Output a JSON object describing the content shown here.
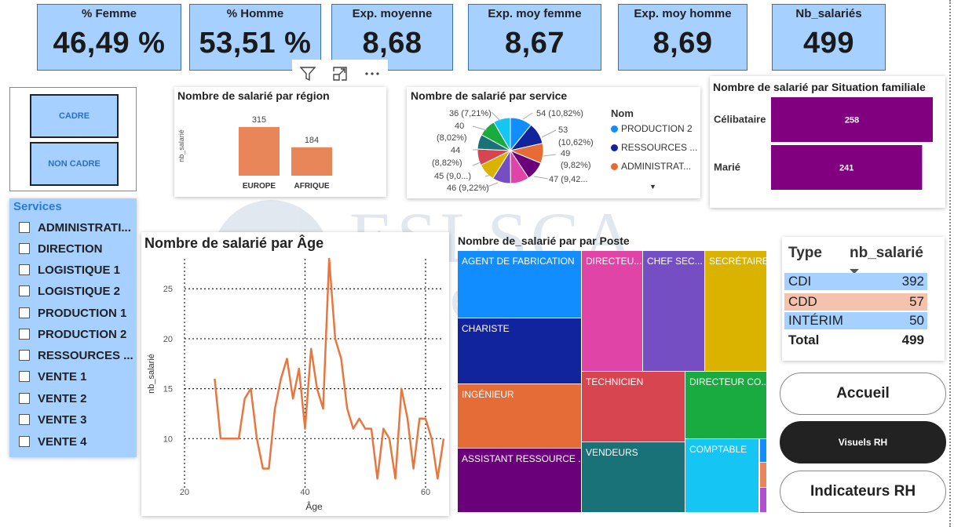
{
  "kpis": [
    {
      "title": "% Femme",
      "value": "46,49 %"
    },
    {
      "title": "% Homme",
      "value": "53,51 %"
    },
    {
      "title": "Exp. moyenne",
      "value": "8,68"
    },
    {
      "title": "Exp. moy femme",
      "value": "8,67"
    },
    {
      "title": "Exp. moy homme",
      "value": "8,69"
    },
    {
      "title": "Nb_salariés",
      "value": "499"
    }
  ],
  "toolbar": {
    "icons": [
      "filter-icon",
      "focus-mode-icon",
      "more-options-icon"
    ]
  },
  "cadre_slicer": {
    "buttons": [
      "CADRE",
      "NON CADRE"
    ]
  },
  "services_slicer": {
    "title": "Services",
    "items": [
      "ADMINISTRATI...",
      "DIRECTION",
      "LOGISTIQUE 1",
      "LOGISTIQUE 2",
      "PRODUCTION 1",
      "PRODUCTION 2",
      "RESSOURCES ...",
      "VENTE 1",
      "VENTE 2",
      "VENTE 3",
      "VENTE 4"
    ]
  },
  "region_chart": {
    "title": "Nombre de salarié par région",
    "ylabel": "nb_salarié",
    "bar_color": "#e8865a"
  },
  "service_chart": {
    "title": "Nombre de salarié par service",
    "legend_title": "Nom",
    "legend_items": [
      "PRODUCTION 2",
      "RESSOURCES ...",
      "ADMINISTRAT..."
    ],
    "legend_more": "▼",
    "labels": {
      "l36": "36 (7,21%)",
      "l40a": "40",
      "l40b": "(8,02%)",
      "l44a": "44",
      "l44b": "(8,82%)",
      "l45": "45 (9,0...)",
      "l46": "46 (9,22%)",
      "r54": "54 (10,82%)",
      "r53a": "53",
      "r53b": "(10,62%)",
      "r49a": "49",
      "r49b": "(9,82%)",
      "r47": "47 (9,42..."
    }
  },
  "family_chart": {
    "title": "Nombre de salarié par Situation familiale",
    "bar_color": "#800080"
  },
  "age_chart": {
    "title": "Nombre de salarié par Âge",
    "line_color": "#e8763f"
  },
  "poste_treemap": {
    "title": "Nombre de_salarié par par Poste",
    "cells": [
      {
        "label": "AGENT DE FABRICATION",
        "color": "#118dff"
      },
      {
        "label": "DIRECTEU...",
        "color": "#e044a7"
      },
      {
        "label": "CHEF SEC...",
        "color": "#744ec2"
      },
      {
        "label": "SECRÉTAIRE",
        "color": "#d9b300"
      },
      {
        "label": "CHARISTE",
        "color": "#12239e"
      },
      {
        "label": "INGÉNIEUR",
        "color": "#e66c37"
      },
      {
        "label": "TECHNICIEN",
        "color": "#d64550"
      },
      {
        "label": "DIRECTEUR CO...",
        "color": "#1aab40"
      },
      {
        "label": "ASSISTANT RESSOURCE ...",
        "color": "#6b007b"
      },
      {
        "label": "VENDEURS",
        "color": "#197278"
      },
      {
        "label": "COMPTABLE",
        "color": "#15c6f4"
      }
    ]
  },
  "type_table": {
    "headers": [
      "Type",
      "nb_salarié"
    ],
    "rows": [
      {
        "type": "CDI",
        "value": "392",
        "color": "#a6d0ff"
      },
      {
        "type": "CDD",
        "value": "57",
        "color": "#f5c3ad"
      },
      {
        "type": "INTÉRIM",
        "value": "50",
        "color": "#a6d0ff"
      }
    ],
    "total_label": "Total",
    "total_value": "499"
  },
  "nav": {
    "home": "Accueil",
    "visuals": "Visuels RH",
    "indicators": "Indicateurs RH"
  },
  "chart_data": [
    {
      "type": "bar",
      "title": "Nombre de salarié par région",
      "categories": [
        "EUROPE",
        "AFRIQUE"
      ],
      "values": [
        315,
        184
      ],
      "xlabel": "",
      "ylabel": "nb_salarié",
      "ylim": [
        0,
        315
      ]
    },
    {
      "type": "pie",
      "title": "Nombre de salarié par service",
      "categories": [
        "PRODUCTION 2",
        "RESSOURCES ...",
        "ADMINISTRAT...",
        "",
        "",
        "",
        "",
        "",
        "",
        "",
        ""
      ],
      "values": [
        54,
        53,
        49,
        47,
        46,
        45,
        44,
        40,
        36,
        43,
        42
      ],
      "colors": [
        "#118dff",
        "#12239e",
        "#e66c37",
        "#6b007b",
        "#e044a7",
        "#744ec2",
        "#d9b300",
        "#d64550",
        "#197278",
        "#1aab40",
        "#15c6f4"
      ]
    },
    {
      "type": "bar",
      "title": "Nombre de salarié par Situation familiale",
      "categories": [
        "Célibataire",
        "Marié"
      ],
      "values": [
        258,
        241
      ],
      "orientation": "horizontal"
    },
    {
      "type": "line",
      "title": "Nombre de salarié par Âge",
      "xlabel": "Âge",
      "ylabel": "nb_salarié",
      "xlim": [
        20,
        63
      ],
      "ylim": [
        5,
        28
      ],
      "xticks": [
        20,
        40,
        60
      ],
      "yticks": [
        10,
        15,
        20,
        25
      ],
      "grid": true,
      "x": [
        25,
        26,
        27,
        28,
        29,
        30,
        31,
        32,
        33,
        34,
        35,
        36,
        37,
        38,
        39,
        40,
        41,
        42,
        43,
        44,
        45,
        46,
        47,
        48,
        49,
        50,
        51,
        52,
        53,
        54,
        55,
        56,
        57,
        58,
        59,
        60,
        61,
        62,
        63
      ],
      "y": [
        16,
        10,
        10,
        10,
        10,
        14,
        15,
        10,
        7,
        7,
        13,
        16,
        18,
        14,
        17,
        11,
        19,
        15,
        13,
        28,
        20,
        18,
        13,
        11,
        12,
        11,
        11,
        6,
        11,
        10,
        6,
        15,
        12,
        7,
        12,
        12,
        10,
        6,
        10
      ]
    },
    {
      "type": "treemap",
      "title": "Nombre de_salarié par par Poste",
      "categories": [
        "AGENT DE FABRICATION",
        "DIRECTEU...",
        "CHEF SEC...",
        "SECRÉTAIRE",
        "CHARISTE",
        "INGÉNIEUR",
        "TECHNICIEN",
        "DIRECTEUR CO...",
        "ASSISTANT RESSOURCE ...",
        "VENDEURS",
        "COMPTABLE"
      ]
    }
  ]
}
